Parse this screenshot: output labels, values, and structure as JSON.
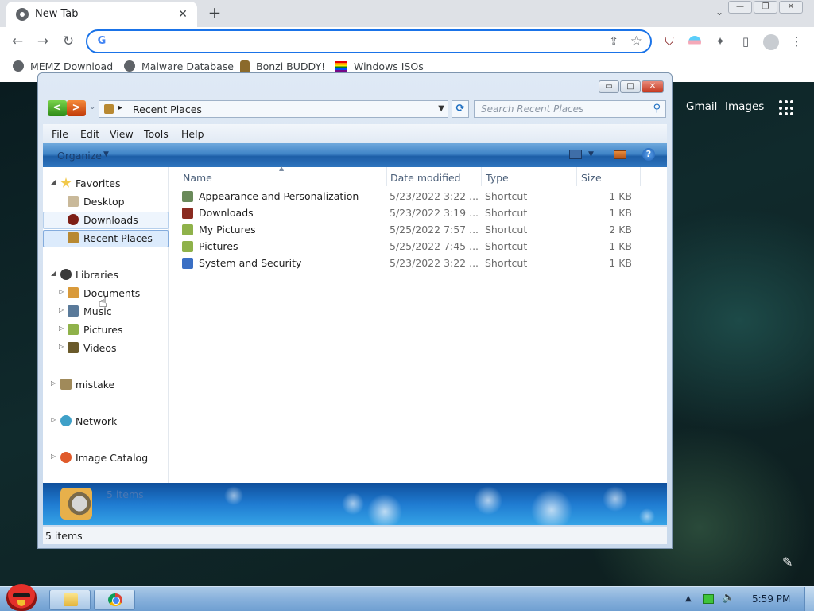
{
  "browser": {
    "tab": {
      "title": "New Tab",
      "close_glyph": "✕",
      "favicon": "chrome-icon"
    },
    "new_tab_glyph": "+",
    "tab_search_glyph": "⌄",
    "window_controls": {
      "minimize": "—",
      "restore": "❐",
      "close": "✕"
    },
    "nav": {
      "back": "←",
      "forward": "→",
      "reload": "↻"
    },
    "omnibox": {
      "value": "",
      "google_glyph": "G",
      "share_glyph": "⇪",
      "star_glyph": "☆"
    },
    "extensions": {
      "ublock": "⛉",
      "puzzle": "✦",
      "sidepanel": "▯",
      "menu": "⋮"
    },
    "bookmarks": [
      {
        "label": "MEMZ Download",
        "icon": "globe-icon"
      },
      {
        "label": "Malware Database",
        "icon": "globe-icon"
      },
      {
        "label": "Bonzi BUDDY!",
        "icon": "bonzi-icon"
      },
      {
        "label": "Windows ISOs",
        "icon": "rainbow-flag-icon"
      }
    ]
  },
  "google_page": {
    "links": [
      "Gmail",
      "Images"
    ],
    "edit_glyph": "✎"
  },
  "explorer": {
    "window_controls": {
      "minimize": "▭",
      "maximize": "□",
      "close": "✕"
    },
    "nav": {
      "back": "<",
      "forward": ">",
      "history": "⌄"
    },
    "address": {
      "separator": "▸",
      "location": "Recent Places",
      "dropdown": "▼"
    },
    "refresh_glyph": "⟳",
    "search": {
      "placeholder": "Search Recent Places",
      "glyph": "⚲"
    },
    "menu": [
      "File",
      "Edit",
      "View",
      "Tools",
      "Help"
    ],
    "command_bar": {
      "organize": "Organize",
      "arrow": "▼",
      "help": "?"
    },
    "nav_pane": {
      "favorites": {
        "label": "Favorites",
        "items": [
          "Desktop",
          "Downloads",
          "Recent Places"
        ]
      },
      "libraries": {
        "label": "Libraries",
        "items": [
          "Documents",
          "Music",
          "Pictures",
          "Videos"
        ]
      },
      "others": [
        "mistake",
        "Network",
        "Image Catalog"
      ],
      "expanded_glyph": "◢",
      "collapsed_glyph": "▷"
    },
    "columns": [
      "Name",
      "Date modified",
      "Type",
      "Size"
    ],
    "files": [
      {
        "name": "Appearance and Personalization",
        "date": "5/23/2022 3:22 ...",
        "type": "Shortcut",
        "size": "1 KB",
        "icon": "appearance-icon",
        "color": "#6a8a5a"
      },
      {
        "name": "Downloads",
        "date": "5/23/2022 3:19 ...",
        "type": "Shortcut",
        "size": "1 KB",
        "icon": "downloads-icon",
        "color": "#8a2b20"
      },
      {
        "name": "My Pictures",
        "date": "5/25/2022 7:57 ...",
        "type": "Shortcut",
        "size": "2 KB",
        "icon": "pictures-icon",
        "color": "#8fb24a"
      },
      {
        "name": "Pictures",
        "date": "5/25/2022 7:45 ...",
        "type": "Shortcut",
        "size": "1 KB",
        "icon": "pictures-icon",
        "color": "#8fb24a"
      },
      {
        "name": "System and Security",
        "date": "5/23/2022 3:22 ...",
        "type": "Shortcut",
        "size": "1 KB",
        "icon": "system-security-icon",
        "color": "#3a6fc4"
      }
    ],
    "details_count": "5 items",
    "status": "5 items"
  },
  "taskbar": {
    "tray_arrow": "▲",
    "volume_glyph": "🔈",
    "clock": "5:59 PM"
  }
}
